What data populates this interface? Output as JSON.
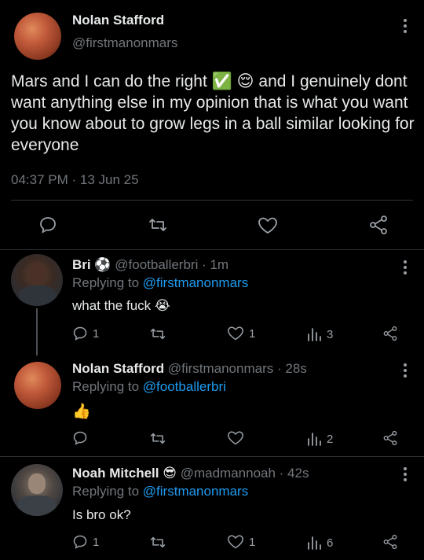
{
  "main_tweet": {
    "name": "Nolan Stafford",
    "handle": "@firstmanonmars",
    "text_part1": "Mars and I can do the right",
    "emoji_check": "✅",
    "emoji_relieved": "😌",
    "text_part2": "and I genuinely",
    "text_rest": "dont want anything else in my opinion that is what you want you know about to grow legs in a ball similar looking for everyone",
    "timestamp": "04:37 PM · 13 Jun 25"
  },
  "replies": [
    {
      "name": "Bri",
      "name_emoji": "⚽",
      "handle": "@footballerbri",
      "time": "· 1m",
      "replying_prefix": "Replying to",
      "replying_to": "@firstmanonmars",
      "text": "what the fuck",
      "text_emoji": "😭",
      "reply_count": "1",
      "like_count": "1",
      "view_count": "3"
    },
    {
      "name": "Nolan Stafford",
      "handle": "@firstmanonmars",
      "time": "· 28s",
      "replying_prefix": "Replying to",
      "replying_to": "@footballerbri",
      "text_emoji": "👍",
      "view_count": "2"
    },
    {
      "name": "Noah Mitchell",
      "name_emoji": "😎",
      "handle": "@madmannoah",
      "time": "· 42s",
      "replying_prefix": "Replying to",
      "replying_to": "@firstmanonmars",
      "text": "Is bro ok?",
      "reply_count": "1",
      "like_count": "1",
      "view_count": "6"
    }
  ],
  "colors": {
    "accent": "#1d9bf0",
    "muted": "#71767b",
    "background": "#000000",
    "divider": "#2f3336"
  }
}
